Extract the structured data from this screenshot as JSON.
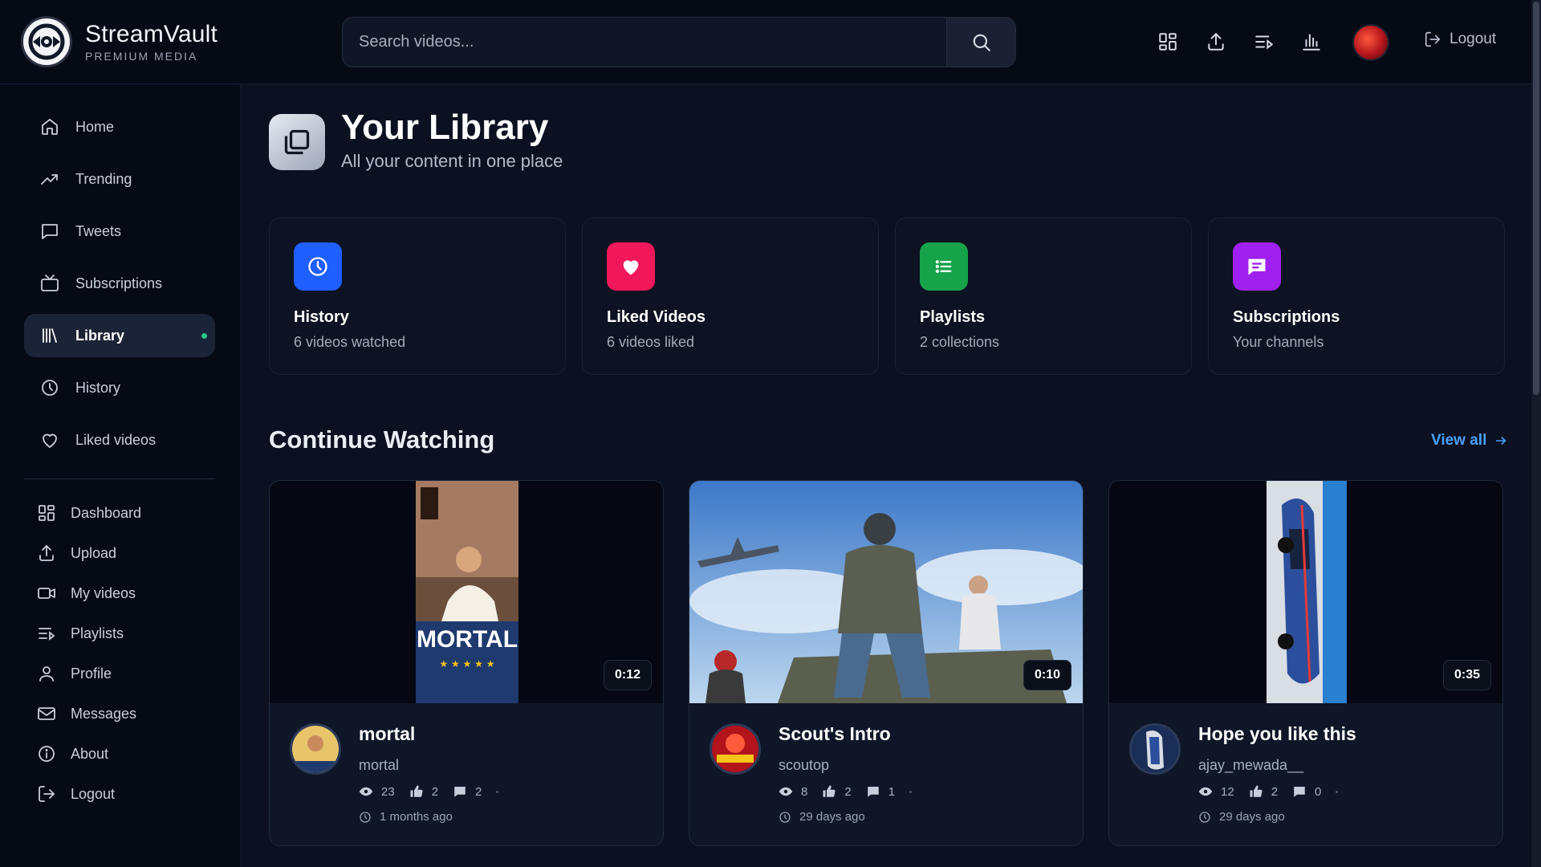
{
  "brand": {
    "name": "StreamVault",
    "tagline": "PREMIUM MEDIA"
  },
  "search": {
    "placeholder": "Search videos..."
  },
  "topbar": {
    "logout_label": "Logout"
  },
  "sidebar": {
    "primary": [
      {
        "label": "Home",
        "icon": "home-icon"
      },
      {
        "label": "Trending",
        "icon": "trending-icon"
      },
      {
        "label": "Tweets",
        "icon": "message-icon"
      },
      {
        "label": "Subscriptions",
        "icon": "tv-icon"
      },
      {
        "label": "Library",
        "icon": "library-icon",
        "active": true
      },
      {
        "label": "History",
        "icon": "clock-icon"
      },
      {
        "label": "Liked videos",
        "icon": "heart-icon"
      }
    ],
    "secondary": [
      {
        "label": "Dashboard",
        "icon": "grid-icon"
      },
      {
        "label": "Upload",
        "icon": "upload-icon"
      },
      {
        "label": "My videos",
        "icon": "video-icon"
      },
      {
        "label": "Playlists",
        "icon": "playlist-icon"
      },
      {
        "label": "Profile",
        "icon": "user-icon"
      },
      {
        "label": "Messages",
        "icon": "mail-icon"
      },
      {
        "label": "About",
        "icon": "info-icon"
      },
      {
        "label": "Logout",
        "icon": "logout-icon"
      }
    ]
  },
  "page": {
    "title": "Your Library",
    "subtitle": "All your content in one place"
  },
  "stats": [
    {
      "title": "History",
      "subtitle": "6 videos watched",
      "color": "#1f5eff",
      "icon": "clock-icon"
    },
    {
      "title": "Liked Videos",
      "subtitle": "6 videos liked",
      "color": "#f0185a",
      "icon": "heart-icon"
    },
    {
      "title": "Playlists",
      "subtitle": "2 collections",
      "color": "#16a34a",
      "icon": "list-icon"
    },
    {
      "title": "Subscriptions",
      "subtitle": "Your channels",
      "color": "#a020f0",
      "icon": "chat-icon"
    }
  ],
  "continue": {
    "title": "Continue Watching",
    "view_all": "View all",
    "videos": [
      {
        "title": "mortal",
        "channel": "mortal",
        "duration": "0:12",
        "views": "23",
        "likes": "2",
        "comments": "2",
        "time": "1 months ago"
      },
      {
        "title": "Scout's Intro",
        "channel": "scoutop",
        "duration": "0:10",
        "views": "8",
        "likes": "2",
        "comments": "1",
        "time": "29 days ago"
      },
      {
        "title": "Hope you like this",
        "channel": "ajay_mewada__",
        "duration": "0:35",
        "views": "12",
        "likes": "2",
        "comments": "0",
        "time": "29 days ago"
      }
    ]
  }
}
